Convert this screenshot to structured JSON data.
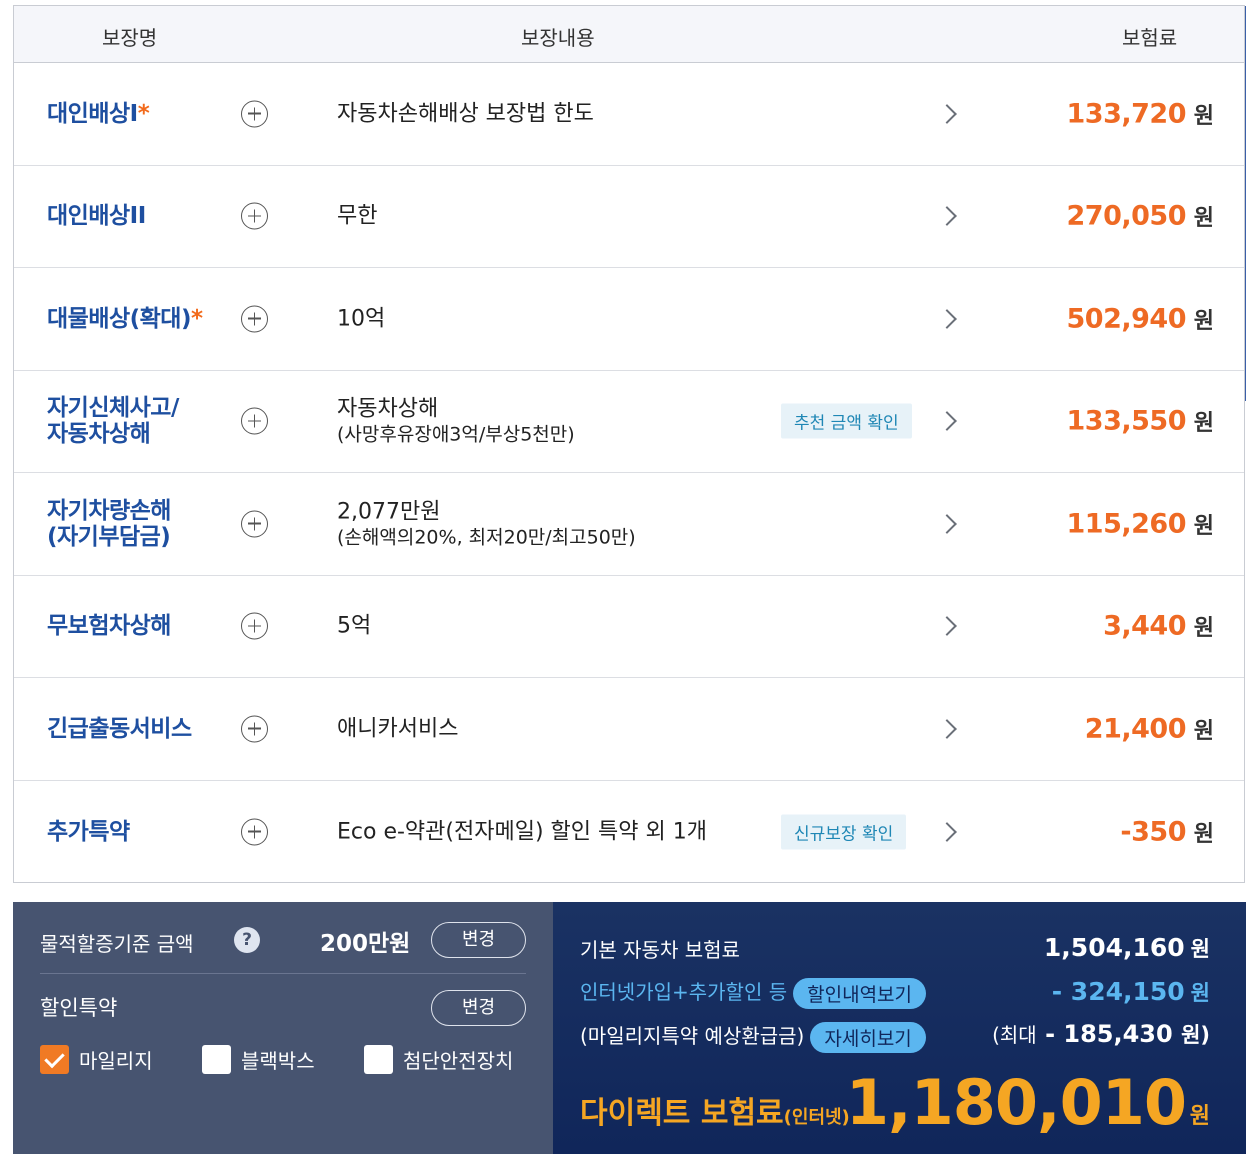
{
  "header": {
    "col_name": "보장명",
    "col_content": "보장내용",
    "col_premium": "보험료"
  },
  "rows": [
    {
      "name": "대인배상I",
      "star": "*",
      "content": "자동차손해배상 보장법 한도",
      "sub": "",
      "tag": "",
      "amount": "133,720",
      "won": "원"
    },
    {
      "name": "대인배상II",
      "star": "",
      "content": "무한",
      "sub": "",
      "tag": "",
      "amount": "270,050",
      "won": "원"
    },
    {
      "name": "대물배상(확대)",
      "star": "*",
      "content": "10억",
      "sub": "",
      "tag": "",
      "amount": "502,940",
      "won": "원"
    },
    {
      "name": "자기신체사고/\n자동차상해",
      "star": "",
      "content": "자동차상해",
      "sub": "(사망후유장애3억/부상5천만)",
      "tag": "추천 금액 확인",
      "amount": "133,550",
      "won": "원"
    },
    {
      "name": "자기차량손해\n(자기부담금)",
      "star": "",
      "content": "2,077만원",
      "sub": "(손해액의20%, 최저20만/최고50만)",
      "tag": "",
      "amount": "115,260",
      "won": "원"
    },
    {
      "name": "무보험차상해",
      "star": "",
      "content": "5억",
      "sub": "",
      "tag": "",
      "amount": "3,440",
      "won": "원"
    },
    {
      "name": "긴급출동서비스",
      "star": "",
      "content": "애니카서비스",
      "sub": "",
      "tag": "",
      "amount": "21,400",
      "won": "원"
    },
    {
      "name": "추가특약",
      "star": "",
      "content": "Eco e-약관(전자메일) 할인 특약 외 1개",
      "sub": "",
      "tag": "신규보장 확인",
      "amount": "-350",
      "won": "원"
    }
  ],
  "left_panel": {
    "threshold_label": "물적할증기준 금액",
    "help_icon": "?",
    "threshold_value": "200만원",
    "change_label": "변경",
    "discount_label": "할인특약",
    "change_label2": "변경",
    "checkboxes": [
      {
        "label": "마일리지",
        "checked": true
      },
      {
        "label": "블랙박스",
        "checked": false
      },
      {
        "label": "첨단안전장치",
        "checked": false
      }
    ]
  },
  "right_panel": {
    "base_label": "기본 자동차 보험료",
    "base_amount": "1,504,160",
    "discount_label": "인터넷가입+추가할인 등",
    "discount_pill": "할인내역보기",
    "discount_amount": "- 324,150",
    "mileage_label": "(마일리지특약 예상환급금)",
    "mileage_pill": "자세히보기",
    "mileage_prefix": "(최대",
    "mileage_amount": "- 185,430",
    "mileage_suffix": "원)",
    "won": "원",
    "direct_label": "다이렉트 보험료",
    "direct_label_small": "(인터넷)",
    "direct_amount": "1,180,010",
    "direct_won": "원"
  },
  "colors": {
    "name_blue": "#1e4fa0",
    "amount_orange": "#ee6a24",
    "accent_blue": "#5bb6f0",
    "direct_gold": "#f5a623"
  }
}
